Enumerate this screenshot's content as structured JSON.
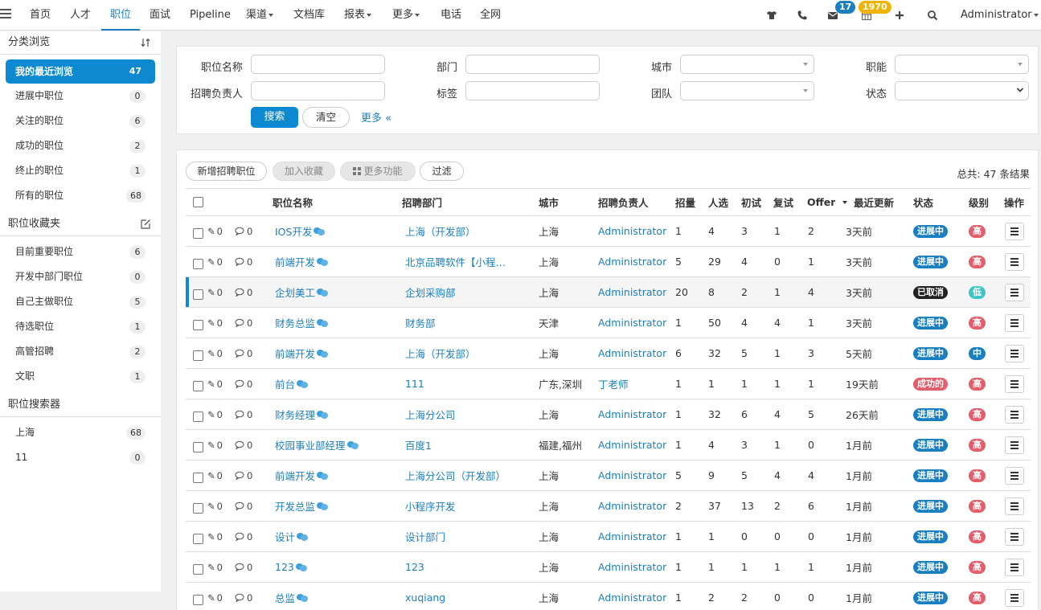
{
  "nav": {
    "items": [
      {
        "label": "首页",
        "dropdown": false,
        "active": false
      },
      {
        "label": "人才",
        "dropdown": false,
        "active": false
      },
      {
        "label": "职位",
        "dropdown": false,
        "active": true
      },
      {
        "label": "面试",
        "dropdown": false,
        "active": false
      },
      {
        "label": "Pipeline",
        "dropdown": false,
        "active": false
      },
      {
        "label": "渠道",
        "dropdown": true,
        "active": false
      },
      {
        "label": "文档库",
        "dropdown": false,
        "active": false
      },
      {
        "label": "报表",
        "dropdown": true,
        "active": false
      },
      {
        "label": "更多",
        "dropdown": true,
        "active": false
      },
      {
        "label": "电话",
        "dropdown": false,
        "active": false
      },
      {
        "label": "全网",
        "dropdown": false,
        "active": false
      }
    ],
    "message_count": "17",
    "calendar_count": "1970",
    "user": "Administrator"
  },
  "sidebar": {
    "browse_title": "分类浏览",
    "browse_items": [
      {
        "label": "我的最近浏览",
        "count": "47"
      },
      {
        "label": "进展中职位",
        "count": "0"
      },
      {
        "label": "关注的职位",
        "count": "6"
      },
      {
        "label": "成功的职位",
        "count": "2"
      },
      {
        "label": "终止的职位",
        "count": "1"
      },
      {
        "label": "所有的职位",
        "count": "68"
      }
    ],
    "favorites_title": "职位收藏夹",
    "favorite_items": [
      {
        "label": "目前重要职位",
        "count": "6"
      },
      {
        "label": "开发中部门职位",
        "count": "0"
      },
      {
        "label": "自己主做职位",
        "count": "5"
      },
      {
        "label": "待选职位",
        "count": "1"
      },
      {
        "label": "高管招聘",
        "count": "2"
      },
      {
        "label": "文职",
        "count": "1"
      }
    ],
    "search_title": "职位搜索器",
    "search_items": [
      {
        "label": "上海",
        "count": "68"
      },
      {
        "label": "11",
        "count": "0"
      }
    ]
  },
  "filters": {
    "position_name": "职位名称",
    "department": "部门",
    "city": "城市",
    "function": "职能",
    "owner": "招聘负责人",
    "tag": "标签",
    "team": "团队",
    "status": "状态",
    "search_btn": "搜索",
    "clear_btn": "清空",
    "more_link": "更多 «"
  },
  "toolbar": {
    "new_btn": "新增招聘职位",
    "fav_btn": "加入收藏",
    "more_btn": "更多功能",
    "filter_btn": "过滤",
    "total": "总共: 47 条结果"
  },
  "table": {
    "headers": {
      "name": "职位名称",
      "dept": "招聘部门",
      "city": "城市",
      "owner": "招聘负责人",
      "quota": "招量",
      "candidates": "人选",
      "first": "初试",
      "second": "复试",
      "offer": "Offer",
      "updated": "最近更新",
      "status": "状态",
      "level": "级别",
      "ops": "操作"
    },
    "rows": [
      {
        "att": "0",
        "cmt": "0",
        "name": "IOS开发",
        "dept": "上海（开发部）",
        "city": "上海",
        "owner": "Administrator",
        "quota": "1",
        "cand": "4",
        "first": "3",
        "second": "1",
        "offer": "2",
        "updated": "3天前",
        "status": "进展中",
        "level": "高"
      },
      {
        "att": "0",
        "cmt": "0",
        "name": "前端开发",
        "dept": "北京品聘软件【小程…",
        "city": "上海",
        "owner": "Administrator",
        "quota": "5",
        "cand": "29",
        "first": "4",
        "second": "0",
        "offer": "1",
        "updated": "3天前",
        "status": "进展中",
        "level": "高"
      },
      {
        "att": "0",
        "cmt": "0",
        "name": "企划美工",
        "dept": "企划采购部",
        "city": "上海",
        "owner": "Administrator",
        "quota": "20",
        "cand": "8",
        "first": "2",
        "second": "1",
        "offer": "4",
        "updated": "3天前",
        "status": "已取消",
        "level": "低"
      },
      {
        "att": "0",
        "cmt": "0",
        "name": "财务总监",
        "dept": "财务部",
        "city": "天津",
        "owner": "Administrator",
        "quota": "1",
        "cand": "50",
        "first": "4",
        "second": "4",
        "offer": "1",
        "updated": "3天前",
        "status": "进展中",
        "level": "高"
      },
      {
        "att": "0",
        "cmt": "0",
        "name": "前端开发",
        "dept": "上海（开发部）",
        "city": "上海",
        "owner": "Administrator",
        "quota": "6",
        "cand": "32",
        "first": "5",
        "second": "1",
        "offer": "3",
        "updated": "5天前",
        "status": "进展中",
        "level": "中"
      },
      {
        "att": "0",
        "cmt": "0",
        "name": "前台",
        "dept": "111",
        "city": "广东,深圳",
        "owner": "丁老师",
        "quota": "1",
        "cand": "1",
        "first": "1",
        "second": "1",
        "offer": "1",
        "updated": "19天前",
        "status": "成功的",
        "level": "高"
      },
      {
        "att": "0",
        "cmt": "0",
        "name": "财务经理",
        "dept": "上海分公司",
        "city": "上海",
        "owner": "Administrator",
        "quota": "1",
        "cand": "32",
        "first": "6",
        "second": "4",
        "offer": "5",
        "updated": "26天前",
        "status": "进展中",
        "level": "高"
      },
      {
        "att": "0",
        "cmt": "0",
        "name": "校园事业部经理",
        "dept": "百度1",
        "city": "福建,福州",
        "owner": "Administrator",
        "quota": "1",
        "cand": "4",
        "first": "3",
        "second": "1",
        "offer": "0",
        "updated": "1月前",
        "status": "进展中",
        "level": "高"
      },
      {
        "att": "0",
        "cmt": "0",
        "name": "前端开发",
        "dept": "上海分公司（开发部）",
        "city": "上海",
        "owner": "Administrator",
        "quota": "5",
        "cand": "9",
        "first": "5",
        "second": "4",
        "offer": "4",
        "updated": "1月前",
        "status": "进展中",
        "level": "高"
      },
      {
        "att": "0",
        "cmt": "0",
        "name": "开发总监",
        "dept": "小程序开发",
        "city": "上海",
        "owner": "Administrator",
        "quota": "2",
        "cand": "37",
        "first": "13",
        "second": "2",
        "offer": "6",
        "updated": "1月前",
        "status": "进展中",
        "level": "高"
      },
      {
        "att": "0",
        "cmt": "0",
        "name": "设计",
        "dept": "设计部门",
        "city": "上海",
        "owner": "Administrator",
        "quota": "1",
        "cand": "1",
        "first": "0",
        "second": "0",
        "offer": "0",
        "updated": "1月前",
        "status": "进展中",
        "level": "高"
      },
      {
        "att": "0",
        "cmt": "0",
        "name": "123",
        "dept": "123",
        "city": "上海",
        "owner": "Administrator",
        "quota": "1",
        "cand": "1",
        "first": "1",
        "second": "1",
        "offer": "1",
        "updated": "1月前",
        "status": "进展中",
        "level": "高"
      },
      {
        "att": "0",
        "cmt": "0",
        "name": "总监",
        "dept": "xuqiang",
        "city": "上海",
        "owner": "Administrator",
        "quota": "1",
        "cand": "2",
        "first": "2",
        "second": "0",
        "offer": "0",
        "updated": "1月前",
        "status": "进展中",
        "level": "高"
      }
    ]
  },
  "colors": {
    "accent": "#0c89d1",
    "status_active": "#1a7fc1",
    "status_cancelled": "#222222",
    "status_success": "#e35d6a",
    "level_high": "#e35d6a",
    "level_low": "#3ec6c6",
    "level_mid": "#1a7fc1",
    "badge_messages": "#1a7fc1",
    "badge_calendar": "#f0b400"
  }
}
